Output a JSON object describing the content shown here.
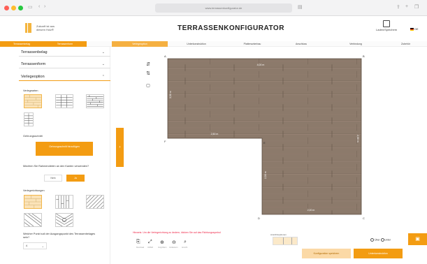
{
  "browser": {
    "url": "www.terrassenkonfigurator.de"
  },
  "header": {
    "tagline": "Zukunft ist aus diesem Holz®",
    "title": "TERRASSENKONFIGURATOR",
    "save_label": "Laden/Speichern",
    "lang_label": "DE"
  },
  "steps": [
    {
      "label": "Terrassenbelag",
      "state": "done"
    },
    {
      "label": "Terrassenform",
      "state": "done"
    },
    {
      "label": "Verlegeoption",
      "state": "active"
    },
    {
      "label": "Unterkonstruktion",
      "state": "todo"
    },
    {
      "label": "Plattenunterbau",
      "state": "todo"
    },
    {
      "label": "Anschluss",
      "state": "todo"
    },
    {
      "label": "Verbindung",
      "state": "todo"
    },
    {
      "label": "Zubehör",
      "state": "todo"
    }
  ],
  "sidebar": {
    "sections": [
      {
        "label": "Terrassenbelag"
      },
      {
        "label": "Terrassenform"
      },
      {
        "label": "Verlegeoption"
      }
    ],
    "verlegearten_label": "Verlegearten",
    "gehrung_label": "Gehrungsschnitt",
    "gehrung_button": "Gehrungsschnitt hinzufügen",
    "rahmen_question": "Möchten Sie Rahmendielen an den Kanten verwenden?",
    "rahmen_no": "Nein",
    "rahmen_yes": "Ja",
    "verlegerichtungen_label": "Verlegerichtungen",
    "startpoint_question": "Welcher Punkt soll der Ausgangspunkt des Terrassenbelages sein?",
    "startpoint_value": "A"
  },
  "canvas": {
    "dimension_top": "4,00 m",
    "dimension_left": "3,50 m",
    "dimension_step": "2,50 m",
    "dimension_right": "2,00 m",
    "dimension_lower_left": "2,50 m",
    "dimension_bottom": "2,00 m",
    "corners": [
      "A",
      "B",
      "C",
      "D",
      "E",
      "F"
    ]
  },
  "footer": {
    "hint": "Hinweis: Um die Verlegerichtung zu ändern, klicken Sie auf das Richtungssymbol",
    "tool_labels": [
      "Download",
      "Vollbild",
      "Vergrößern",
      "Verkleinern",
      "Ansicht"
    ],
    "view_label": "Ansichtsoptionen",
    "toggle_left": "Über",
    "toggle_right": "Unter",
    "back_button": "Konfiguration speichern",
    "next_button": "Unterkonstruktion"
  },
  "colors": {
    "accent": "#f39c12",
    "deck": "#8c7a6b"
  }
}
